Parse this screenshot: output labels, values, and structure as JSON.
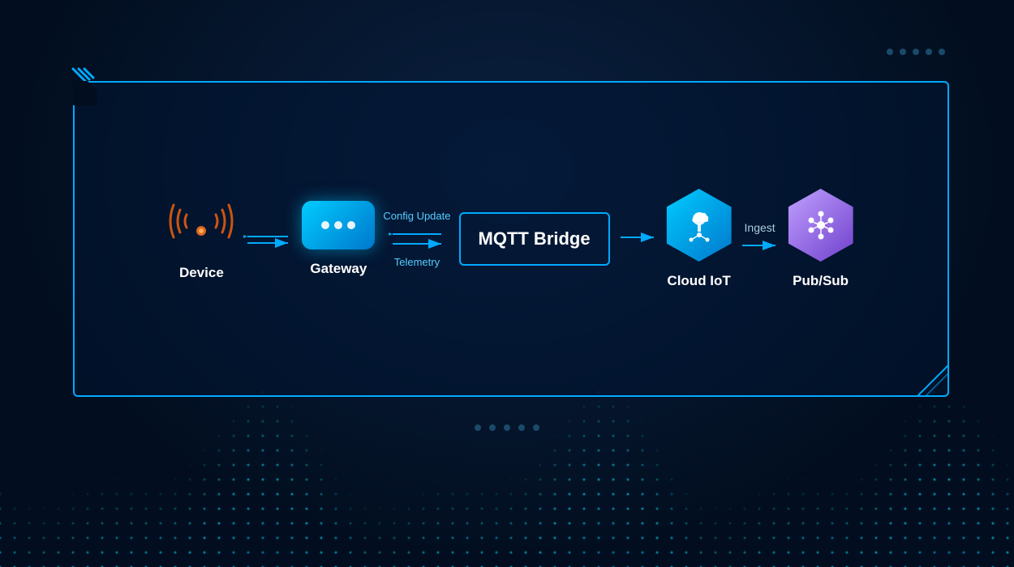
{
  "background": {
    "color": "#020e1f"
  },
  "dots_top_right": [
    "dot1",
    "dot2",
    "dot3",
    "dot4",
    "dot5"
  ],
  "dots_bottom_center": [
    "dot1",
    "dot2",
    "dot3",
    "dot4",
    "dot5"
  ],
  "diagram": {
    "nodes": [
      {
        "id": "device",
        "label": "Device",
        "type": "wifi"
      },
      {
        "id": "gateway",
        "label": "Gateway",
        "type": "box"
      },
      {
        "id": "mqtt",
        "label": "MQTT Bridge",
        "type": "text"
      },
      {
        "id": "cloudiot",
        "label": "Cloud IoT",
        "type": "hexagon-blue"
      },
      {
        "id": "pubsub",
        "label": "Pub/Sub",
        "type": "hexagon-purple"
      }
    ],
    "arrows": [
      {
        "id": "device-gateway",
        "type": "double",
        "label": ""
      },
      {
        "id": "gateway-mqtt-config",
        "label": "Config Update",
        "direction": "down"
      },
      {
        "id": "gateway-mqtt-telemetry",
        "label": "Telemetry",
        "direction": "up"
      },
      {
        "id": "mqtt-cloudiot",
        "type": "single-right",
        "label": ""
      },
      {
        "id": "cloudiot-pubsub",
        "type": "single-right",
        "label": "Ingest"
      }
    ]
  }
}
